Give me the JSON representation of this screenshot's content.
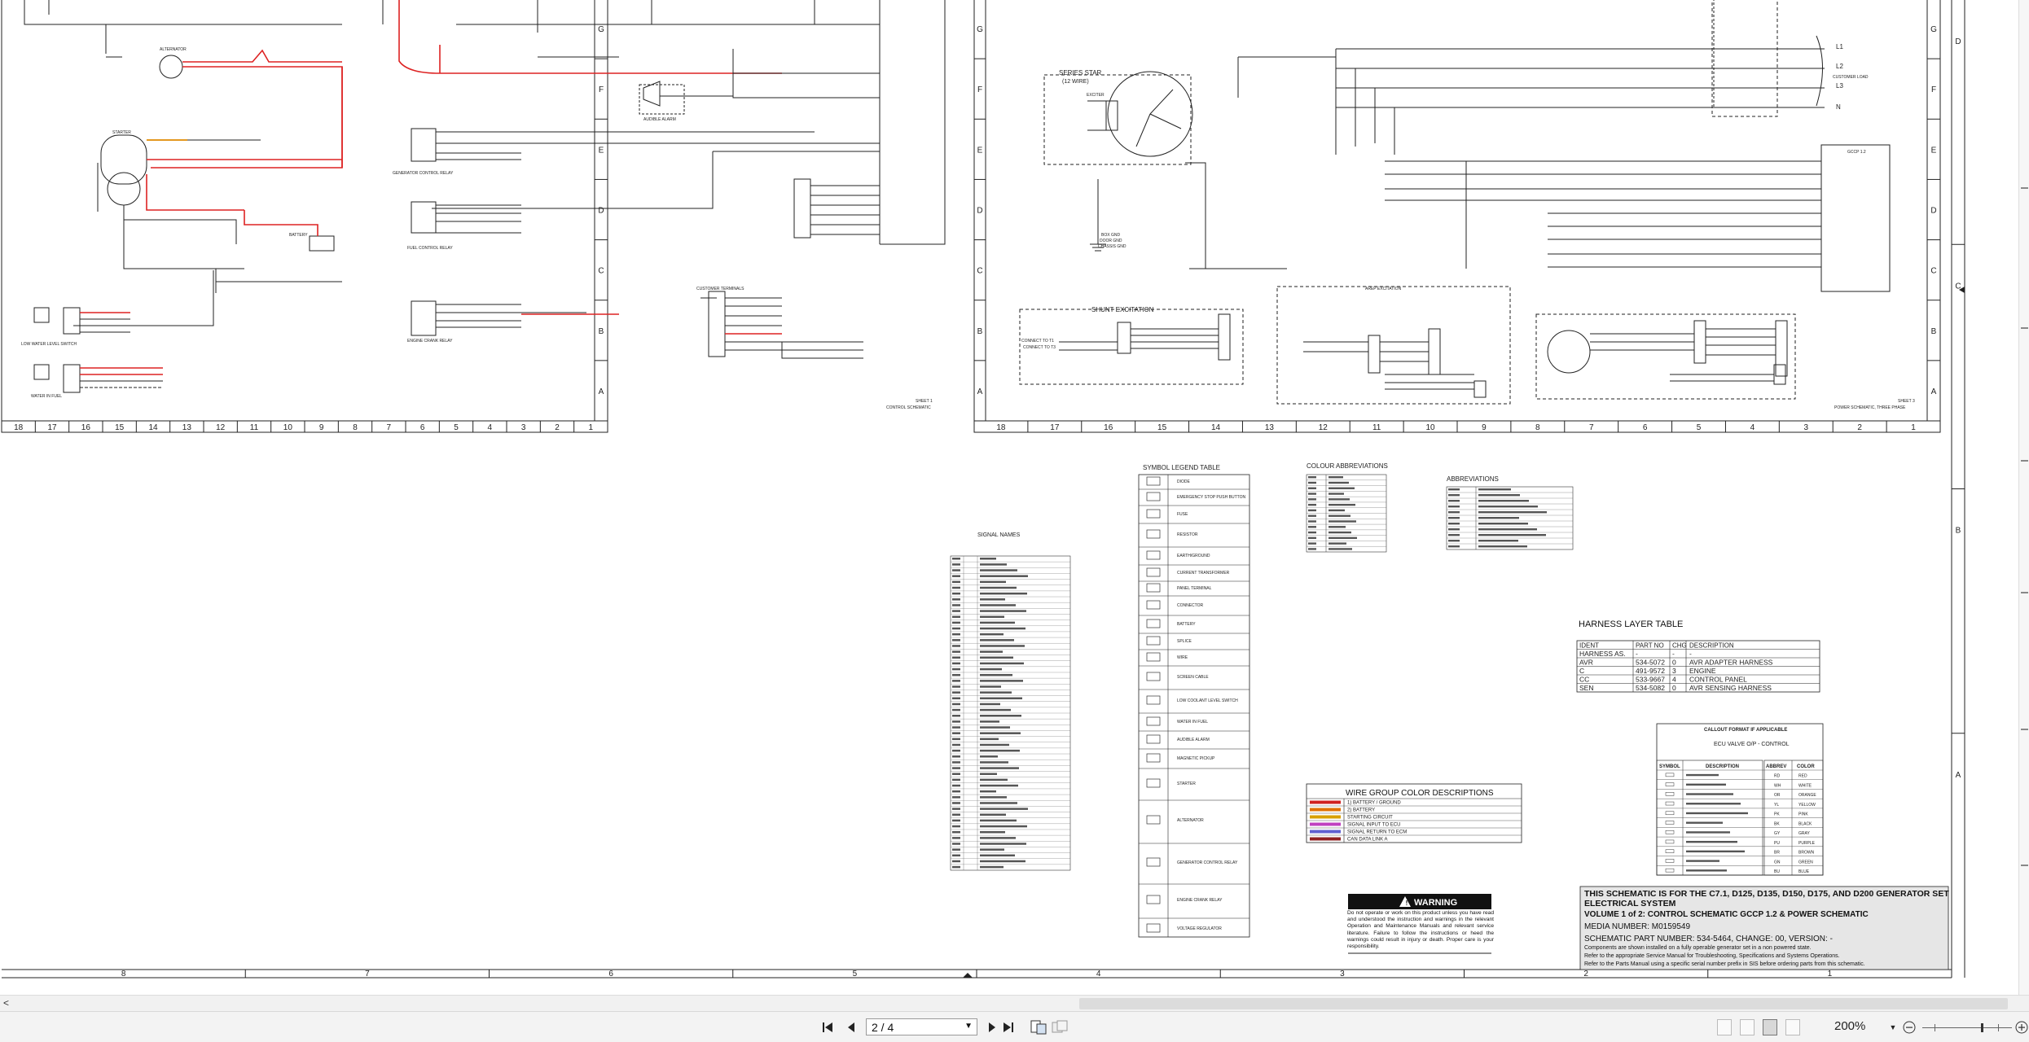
{
  "sheet1": {
    "title": "SHEET 1",
    "subtitle": "CONTROL SCHEMATIC",
    "zones_row": [
      "G",
      "F",
      "E",
      "D",
      "C",
      "B",
      "A"
    ],
    "cols": [
      "18",
      "17",
      "16",
      "15",
      "14",
      "13",
      "12",
      "11",
      "10",
      "9",
      "8",
      "7",
      "6",
      "5",
      "4",
      "3",
      "2",
      "1"
    ],
    "labels": {
      "alternator": "ALTERNATOR",
      "starter": "STARTER",
      "battery": "BATTERY",
      "audible_alarm": "AUDIBLE ALARM",
      "gen_control_relay": "GENERATOR CONTROL RELAY",
      "fuel_control_relay": "FUEL CONTROL RELAY",
      "engine_crank_relay": "ENGINE CRANK RELAY",
      "low_water": "LOW WATER LEVEL SWITCH",
      "water_in_fuel": "WATER IN FUEL",
      "customer_terminals": "CUSTOMER TERMINALS"
    }
  },
  "sheet3": {
    "title": "SHEET 3",
    "subtitle": "POWER SCHEMATIC, THREE PHASE",
    "cols": [
      "18",
      "17",
      "16",
      "15",
      "14",
      "13",
      "12",
      "11",
      "10",
      "9",
      "8",
      "7",
      "6",
      "5",
      "4",
      "3",
      "2",
      "1"
    ],
    "labels": {
      "series_star": "SERIES STAR",
      "series_star_sub": "(12 WIRE)",
      "exciter": "EXCITER",
      "shunt": "SHUNT EXCITATION",
      "arep": "AREP EXCITATION",
      "customer_load": "CUSTOMER LOAD",
      "gccp": "GCCP 1.2",
      "gnd": "BOX GND\nDOOR GND\nCHASSIS GND",
      "l1": "L1",
      "l2": "L2",
      "l3": "L3",
      "n": "N",
      "connect_t1": "CONNECT TO T1",
      "connect_t3": "CONNECT TO T3"
    }
  },
  "outer_zones_right": [
    "D",
    "C",
    "B",
    "A"
  ],
  "bottom_cols": [
    "8",
    "7",
    "6",
    "5",
    "4",
    "3",
    "2",
    "1"
  ],
  "legend": {
    "symbol_title": "SYMBOL LEGEND TABLE",
    "symbols": [
      "DIODE",
      "EMERGENCY STOP PUSH BUTTON",
      "FUSE",
      "RESISTOR",
      "EARTH/GROUND",
      "CURRENT TRANSFORMER",
      "PANEL TERMINAL",
      "CONNECTOR",
      "BATTERY",
      "SPLICE",
      "WIRE",
      "SCREEN CABLE",
      "LOW COOLANT LEVEL SWITCH",
      "WATER IN FUEL",
      "AUDIBLE ALARM",
      "MAGNETIC PICKUP",
      "STARTER",
      "ALTERNATOR",
      "GENERATOR CONTROL RELAY",
      "ENGINE CRANK RELAY",
      "VOLTAGE REGULATOR"
    ],
    "signal_title": "SIGNAL NAMES",
    "colour_title": "COLOUR ABBREVIATIONS",
    "abbr_title": "ABBREVIATIONS"
  },
  "harness": {
    "title": "HARNESS LAYER TABLE",
    "headers": [
      "IDENT",
      "PART NO",
      "CHG",
      "DESCRIPTION"
    ],
    "rows": [
      [
        "HARNESS AS.",
        "-",
        "-",
        "-"
      ],
      [
        "AVR",
        "534-5072",
        "0",
        "AVR ADAPTER HARNESS"
      ],
      [
        "C",
        "491-9572",
        "3",
        "ENGINE"
      ],
      [
        "CC",
        "533-9667",
        "4",
        "CONTROL PANEL"
      ],
      [
        "SEN",
        "534-5082",
        "0",
        "AVR SENSING HARNESS"
      ]
    ]
  },
  "callout": {
    "title": "CALLOUT FORMAT IF APPLICABLE",
    "example": "ECU VALVE O/P - CONTROL",
    "headers_left": [
      "SYMBOL",
      "DESCRIPTION"
    ],
    "headers_right": [
      "ABBREV",
      "COLOR"
    ],
    "colors": [
      [
        "RD",
        "RED"
      ],
      [
        "WH",
        "WHITE"
      ],
      [
        "OR",
        "ORANGE"
      ],
      [
        "YL",
        "YELLOW"
      ],
      [
        "PK",
        "PINK"
      ],
      [
        "BK",
        "BLACK"
      ],
      [
        "GY",
        "GRAY"
      ],
      [
        "PU",
        "PURPLE"
      ],
      [
        "BR",
        "BROWN"
      ],
      [
        "GN",
        "GREEN"
      ],
      [
        "BU",
        "BLUE"
      ]
    ]
  },
  "wire_group": {
    "title": "WIRE GROUP COLOR DESCRIPTIONS",
    "items": [
      {
        "color": "#d02020",
        "label": "1) BATTERY / GROUND"
      },
      {
        "color": "#e07000",
        "label": "2) BATTERY"
      },
      {
        "color": "#d8a000",
        "label": "STARTING CIRCUIT"
      },
      {
        "color": "#c040c0",
        "label": "SIGNAL INPUT TO ECU"
      },
      {
        "color": "#6060d0",
        "label": "SIGNAL RETURN TO ECM"
      },
      {
        "color": "#902020",
        "label": "CAN DATA LINK A"
      }
    ]
  },
  "warning": {
    "title": "WARNING",
    "text": "Do not operate or work on this product unless you have read and understood the instruction and warnings in the relevant Operation and Maintenance Manuals and relevant service literature. Failure to follow the instructions or heed the warnings could result in injury or death. Proper care is your responsibility."
  },
  "title_block": {
    "line1": "THIS SCHEMATIC IS FOR THE C7.1, D125, D135, D150, D175, AND D200 GENERATOR SET",
    "line2": "ELECTRICAL SYSTEM",
    "line3": "VOLUME 1 of 2: CONTROL SCHEMATIC GCCP 1.2 & POWER SCHEMATIC",
    "line4": "MEDIA NUMBER: M0159549",
    "line5": "SCHEMATIC PART NUMBER: 534-5464, CHANGE: 00, VERSION: -",
    "line6": "Components are shown installed on a fully operable generator set in a non powered state.",
    "line7": "Refer to the appropriate Service Manual for Troubleshooting, Specifications and Systems Operations.",
    "line8": "Refer to the Parts Manual using a specific serial number prefix in SIS before ordering parts from this schematic."
  },
  "viewer": {
    "page_value": "2 / 4",
    "zoom": "200%",
    "scroll_left_arrow": "<"
  },
  "colors": {
    "wire_red": "#d22",
    "wire_orange": "#e08a00",
    "frame": "#222",
    "toolbar_bg": "#f3f3f3"
  }
}
